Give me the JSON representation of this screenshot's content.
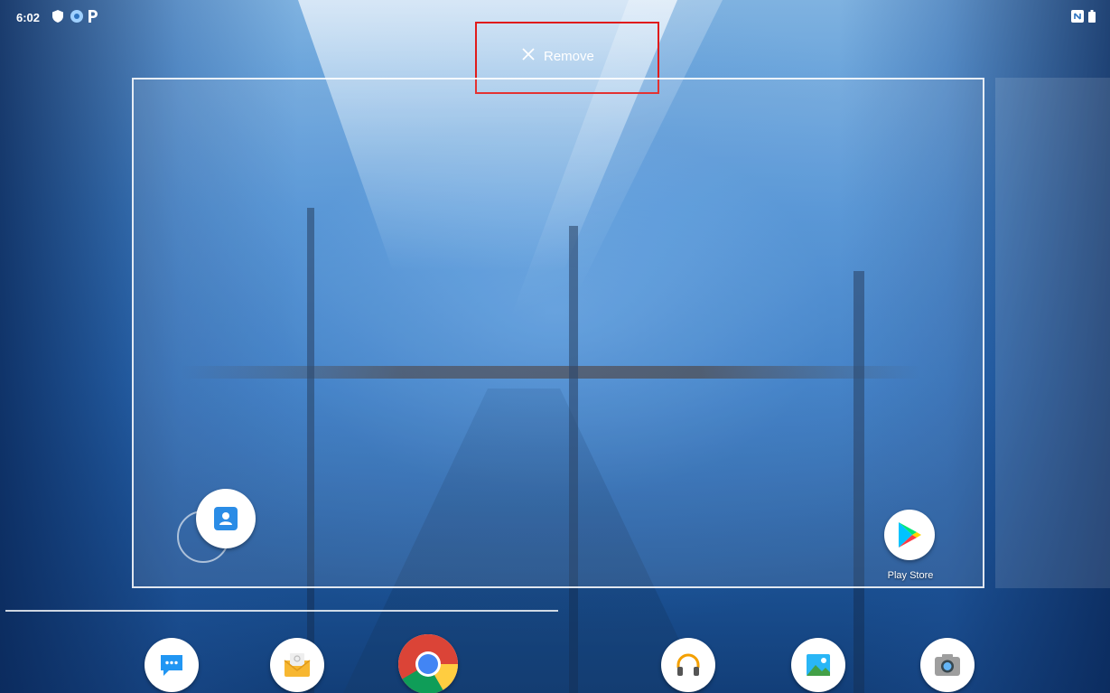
{
  "status_bar": {
    "time": "6:02",
    "left_icons": [
      "shield-icon",
      "account-icon",
      "parking-icon"
    ],
    "right_icons": [
      "nfc-icon",
      "battery-icon"
    ]
  },
  "remove_target": {
    "label": "Remove",
    "icon": "close-icon",
    "highlight_color": "#e01b1b"
  },
  "workspace": {
    "apps": [
      {
        "name": "Contacts",
        "label": "",
        "icon": "contacts-icon"
      },
      {
        "name": "Play Store",
        "label": "Play Store",
        "icon": "play-store-icon"
      }
    ]
  },
  "hotseat": {
    "apps": [
      {
        "icon": "messages-icon"
      },
      {
        "icon": "email-icon"
      },
      {
        "icon": "chrome-icon"
      },
      {
        "icon": "music-icon"
      },
      {
        "icon": "gallery-icon"
      },
      {
        "icon": "camera-icon"
      }
    ]
  },
  "colors": {
    "accent": "#e01b1b",
    "wallpaper": "#2f74c0"
  }
}
